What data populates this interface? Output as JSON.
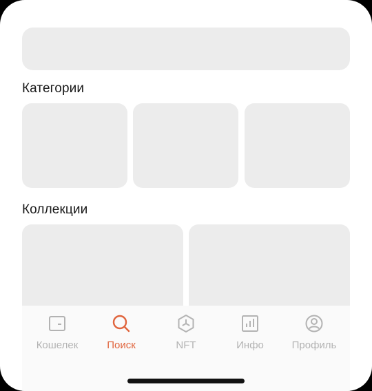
{
  "sections": {
    "categories_title": "Категории",
    "collections_title": "Коллекции"
  },
  "tabbar": {
    "active_color": "#e0643c",
    "inactive_color": "#b3b3b3",
    "tabs": [
      {
        "label": "Кошелек",
        "icon": "wallet-icon",
        "active": false
      },
      {
        "label": "Поиск",
        "icon": "search-icon",
        "active": true
      },
      {
        "label": "NFT",
        "icon": "nft-hexagon-icon",
        "active": false
      },
      {
        "label": "Инфо",
        "icon": "bar-chart-icon",
        "active": false
      },
      {
        "label": "Профиль",
        "icon": "profile-icon",
        "active": false
      }
    ]
  }
}
